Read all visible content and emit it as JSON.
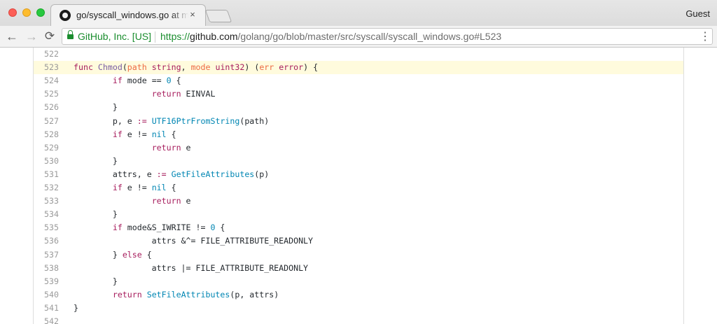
{
  "window": {
    "tab_title": "go/syscall_windows.go at master",
    "tab_close": "×",
    "profile_name": "Guest"
  },
  "toolbar": {
    "back": "←",
    "forward": "→",
    "reload": "⟳",
    "ev_name": "GitHub, Inc. [US]",
    "url_scheme": "https://",
    "url_host": "github.com",
    "url_path": "/golang/go/blob/master/src/syscall/syscall_windows.go#L523",
    "menu": "⋮"
  },
  "code": {
    "highlighted_line": "523",
    "lines": [
      {
        "n": "522",
        "tokens": []
      },
      {
        "n": "523",
        "tokens": [
          [
            "kw",
            "func "
          ],
          [
            "fn",
            "Chmod"
          ],
          [
            "",
            "("
          ],
          [
            "ty",
            "path "
          ],
          [
            "kw",
            "string"
          ],
          [
            "",
            ", "
          ],
          [
            "ty",
            "mode "
          ],
          [
            "kw",
            "uint32"
          ],
          [
            "",
            ") ("
          ],
          [
            "ty",
            "err "
          ],
          [
            "kw",
            "error"
          ],
          [
            "",
            ") {"
          ]
        ]
      },
      {
        "n": "524",
        "tokens": [
          [
            "",
            "\t"
          ],
          [
            "kw",
            "if"
          ],
          [
            "",
            " mode == "
          ],
          [
            "num",
            "0"
          ],
          [
            "",
            " {"
          ]
        ]
      },
      {
        "n": "525",
        "tokens": [
          [
            "",
            "\t\t"
          ],
          [
            "kw",
            "return"
          ],
          [
            "",
            " EINVAL"
          ]
        ]
      },
      {
        "n": "526",
        "tokens": [
          [
            "",
            "\t}"
          ]
        ]
      },
      {
        "n": "527",
        "tokens": [
          [
            "",
            "\tp, e "
          ],
          [
            "kw",
            ":="
          ],
          [
            " ",
            ""
          ],
          [
            "call",
            " UTF16PtrFromString"
          ],
          [
            "",
            "(path)"
          ]
        ]
      },
      {
        "n": "528",
        "tokens": [
          [
            "",
            "\t"
          ],
          [
            "kw",
            "if"
          ],
          [
            "",
            " e != "
          ],
          [
            "num",
            "nil"
          ],
          [
            "",
            " {"
          ]
        ]
      },
      {
        "n": "529",
        "tokens": [
          [
            "",
            "\t\t"
          ],
          [
            "kw",
            "return"
          ],
          [
            "",
            " e"
          ]
        ]
      },
      {
        "n": "530",
        "tokens": [
          [
            "",
            "\t}"
          ]
        ]
      },
      {
        "n": "531",
        "tokens": [
          [
            "",
            "\tattrs, e "
          ],
          [
            "kw",
            ":="
          ],
          [
            "call",
            " GetFileAttributes"
          ],
          [
            "",
            "(p)"
          ]
        ]
      },
      {
        "n": "532",
        "tokens": [
          [
            "",
            "\t"
          ],
          [
            "kw",
            "if"
          ],
          [
            "",
            " e != "
          ],
          [
            "num",
            "nil"
          ],
          [
            "",
            " {"
          ]
        ]
      },
      {
        "n": "533",
        "tokens": [
          [
            "",
            "\t\t"
          ],
          [
            "kw",
            "return"
          ],
          [
            "",
            " e"
          ]
        ]
      },
      {
        "n": "534",
        "tokens": [
          [
            "",
            "\t}"
          ]
        ]
      },
      {
        "n": "535",
        "tokens": [
          [
            "",
            "\t"
          ],
          [
            "kw",
            "if"
          ],
          [
            "",
            " mode&S_IWRITE != "
          ],
          [
            "num",
            "0"
          ],
          [
            "",
            " {"
          ]
        ]
      },
      {
        "n": "536",
        "tokens": [
          [
            "",
            "\t\tattrs &^= FILE_ATTRIBUTE_READONLY"
          ]
        ]
      },
      {
        "n": "537",
        "tokens": [
          [
            "",
            "\t} "
          ],
          [
            "kw",
            "else"
          ],
          [
            "",
            " {"
          ]
        ]
      },
      {
        "n": "538",
        "tokens": [
          [
            "",
            "\t\tattrs |= FILE_ATTRIBUTE_READONLY"
          ]
        ]
      },
      {
        "n": "539",
        "tokens": [
          [
            "",
            "\t}"
          ]
        ]
      },
      {
        "n": "540",
        "tokens": [
          [
            "",
            "\t"
          ],
          [
            "kw",
            "return"
          ],
          [
            "call",
            " SetFileAttributes"
          ],
          [
            "",
            "(p, attrs)"
          ]
        ]
      },
      {
        "n": "541",
        "tokens": [
          [
            "",
            "}"
          ]
        ]
      },
      {
        "n": "542",
        "tokens": []
      }
    ]
  },
  "colors": {
    "keyword": "#a71d5d",
    "function_name": "#795da3",
    "builtin_call": "#0086b3",
    "param_name": "#ed6a43",
    "highlight": "#fffbdd",
    "secure": "#1a8d2e"
  },
  "icons": {
    "favicon": "github-octocat-icon",
    "lock": "lock-icon"
  }
}
